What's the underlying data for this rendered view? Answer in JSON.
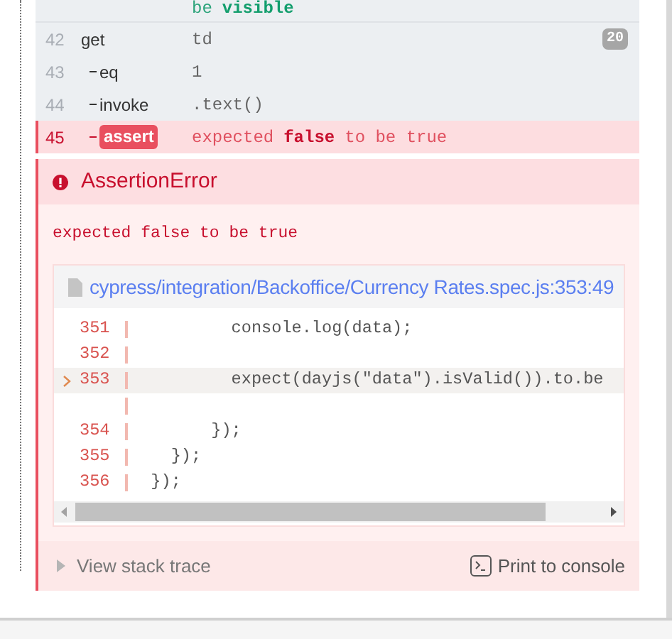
{
  "commands": [
    {
      "child": false,
      "failed": false,
      "message": [
        {
          "text": "be",
          "emphasis": false
        },
        {
          "text": "visible",
          "emphasis": true
        }
      ]
    },
    {
      "number": "42",
      "name": "get",
      "child": false,
      "failed": false,
      "message": [
        {
          "text": "td",
          "emphasis": false
        }
      ],
      "badge": "20"
    },
    {
      "number": "43",
      "name": "eq",
      "child": true,
      "failed": false,
      "message": [
        {
          "text": "1",
          "emphasis": false
        }
      ]
    },
    {
      "number": "44",
      "name": "invoke",
      "child": true,
      "failed": false,
      "message": [
        {
          "text": ".text()",
          "emphasis": false
        }
      ]
    },
    {
      "number": "45",
      "name": "assert",
      "child": true,
      "failed": true,
      "message": [
        {
          "text": "expected",
          "emphasis": false
        },
        {
          "text": "false",
          "emphasis": true
        },
        {
          "text": "to be true",
          "emphasis": false
        }
      ]
    }
  ],
  "error": {
    "title": "AssertionError",
    "message": "expected false to be true",
    "file": "cypress/integration/Backoffice/Currency Rates.spec.js:353:49",
    "code_lines": [
      {
        "number": "351",
        "code": "          console.log(data);",
        "highlighted": false,
        "wrapped": false
      },
      {
        "number": "352",
        "highlighted": false,
        "wrapped": false
      },
      {
        "number": "353",
        "code": "          expect(dayjs(\"data\").isValid()).to.be",
        "highlighted": true,
        "wrapped": true
      },
      {
        "number": "354",
        "code": "        });",
        "highlighted": false,
        "wrapped": false
      },
      {
        "number": "355",
        "code": "    });",
        "highlighted": false,
        "wrapped": false
      },
      {
        "number": "356",
        "code": "  });",
        "highlighted": false,
        "wrapped": false
      }
    ],
    "stack_trace": {
      "label": "View stack trace",
      "expanded": false
    },
    "print_button": "Print to console"
  }
}
